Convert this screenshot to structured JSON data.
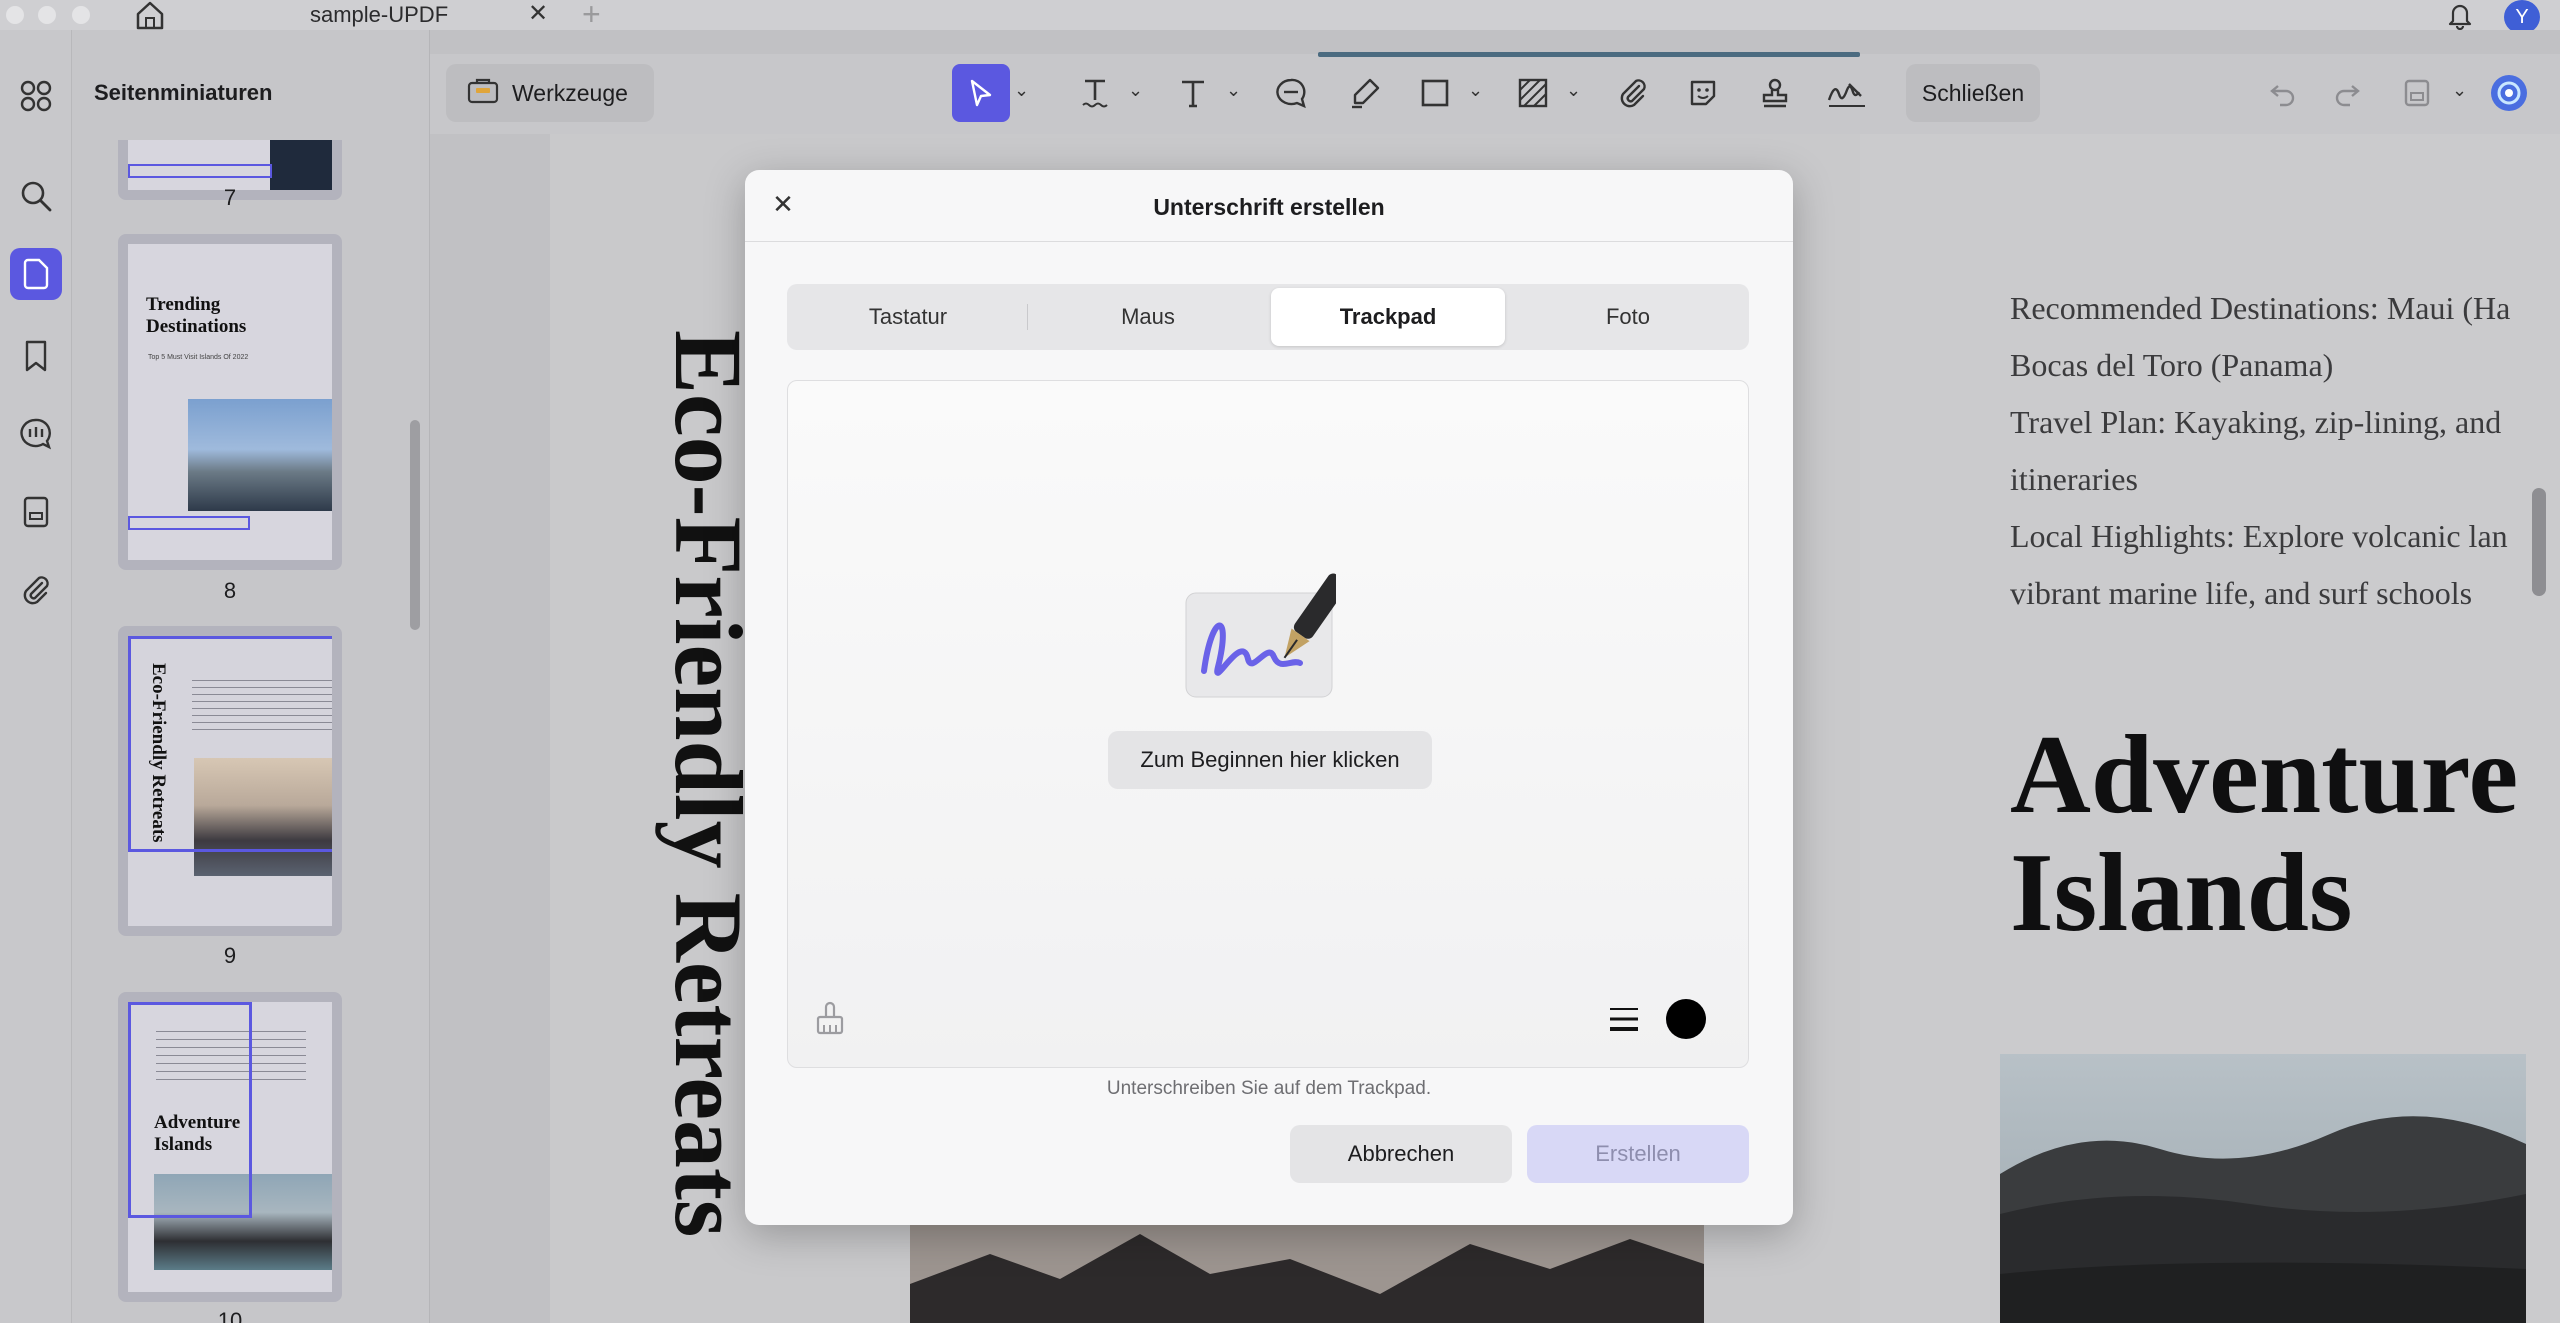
{
  "titlebar": {
    "tab_title": "sample-UPDF",
    "tab_close": "✕",
    "tab_add": "+",
    "avatar_initial": "Y"
  },
  "sidebar": {
    "title": "Seitenminiaturen",
    "pages": [
      {
        "number": "7"
      },
      {
        "number": "8",
        "title": "Trending Destinations",
        "subtitle": "Top 5 Must Visit Islands Of 2022"
      },
      {
        "number": "9",
        "title": "Eco-Friendly Retreats"
      },
      {
        "number": "10",
        "title": "Adventure Islands"
      }
    ]
  },
  "toolbar": {
    "tools_label": "Werkzeuge",
    "close_label": "Schließen"
  },
  "document": {
    "vertical_title": "Eco-Friendly Retreats",
    "right_lines": [
      "Recommended Destinations: Maui (Ha",
      "Bocas del Toro (Panama)",
      "Travel Plan: Kayaking, zip-lining, and",
      "itineraries",
      "Local Highlights: Explore volcanic lan",
      "vibrant marine life, and surf schools"
    ],
    "heading_line1": "Adventure",
    "heading_line2": "Islands"
  },
  "modal": {
    "title": "Unterschrift erstellen",
    "close": "✕",
    "tabs": [
      {
        "label": "Tastatur",
        "active": false
      },
      {
        "label": "Maus",
        "active": false
      },
      {
        "label": "Trackpad",
        "active": true
      },
      {
        "label": "Foto",
        "active": false
      }
    ],
    "start_label": "Zum Beginnen hier klicken",
    "hint": "Unterschreiben Sie auf dem Trackpad.",
    "cancel_label": "Abbrechen",
    "create_label": "Erstellen",
    "pen_color": "#000000"
  },
  "colors": {
    "accent": "#5b58e0"
  }
}
